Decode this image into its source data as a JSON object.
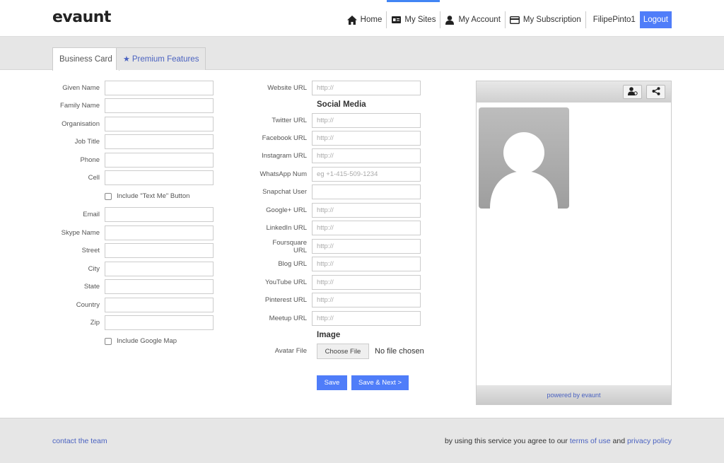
{
  "header": {
    "logo": "evaunt",
    "nav": [
      {
        "label": "Home",
        "icon": "home-icon"
      },
      {
        "label": "My Sites",
        "icon": "id-card-icon"
      },
      {
        "label": "My Account",
        "icon": "user-icon"
      },
      {
        "label": "My Subscription",
        "icon": "credit-card-icon"
      }
    ],
    "username": "FilipePinto1",
    "logout_label": "Logout"
  },
  "tabs": [
    {
      "label": "Business Card"
    },
    {
      "label": "Premium Features",
      "icon": "star-icon"
    }
  ],
  "form_left": {
    "fields": [
      {
        "label": "Given Name",
        "value": ""
      },
      {
        "label": "Family Name",
        "value": ""
      },
      {
        "label": "Organisation",
        "value": ""
      },
      {
        "label": "Job Title",
        "value": ""
      },
      {
        "label": "Phone",
        "value": ""
      },
      {
        "label": "Cell",
        "value": ""
      }
    ],
    "text_me_label": "Include \"Text Me\" Button",
    "fields2": [
      {
        "label": "Email",
        "value": ""
      },
      {
        "label": "Skype Name",
        "value": ""
      },
      {
        "label": "Street",
        "value": ""
      },
      {
        "label": "City",
        "value": ""
      },
      {
        "label": "State",
        "value": ""
      },
      {
        "label": "Country",
        "value": ""
      },
      {
        "label": "Zip",
        "value": ""
      }
    ],
    "google_map_label": "Include Google Map"
  },
  "form_right": {
    "website": {
      "label": "Website URL",
      "placeholder": "http://"
    },
    "social_heading": "Social Media",
    "social": [
      {
        "label": "Twitter URL",
        "placeholder": "http://"
      },
      {
        "label": "Facebook URL",
        "placeholder": "http://"
      },
      {
        "label": "Instagram URL",
        "placeholder": "http://"
      },
      {
        "label": "WhatsApp Num",
        "placeholder": "eg +1-415-509-1234"
      },
      {
        "label": "Snapchat User",
        "placeholder": ""
      },
      {
        "label": "Google+ URL",
        "placeholder": "http://"
      },
      {
        "label": "LinkedIn URL",
        "placeholder": "http://"
      },
      {
        "label": "Foursquare URL",
        "placeholder": "http://"
      },
      {
        "label": "Blog URL",
        "placeholder": "http://"
      },
      {
        "label": "YouTube URL",
        "placeholder": "http://"
      },
      {
        "label": "Pinterest URL",
        "placeholder": "http://"
      },
      {
        "label": "Meetup URL",
        "placeholder": "http://"
      }
    ],
    "image_heading": "Image",
    "avatar_label": "Avatar File",
    "choose_file_label": "Choose File",
    "no_file_label": "No file chosen",
    "save_label": "Save",
    "save_next_label": "Save & Next >"
  },
  "preview": {
    "powered_by": "powered by evaunt"
  },
  "footer": {
    "contact": "contact the team",
    "terms_prefix": "by using this service you agree to our",
    "terms_link": "terms of use",
    "and": "and",
    "privacy_link": "privacy policy"
  },
  "colors": {
    "accent": "#4f7df9",
    "link": "#4a62c0",
    "band": "#e6e6e6"
  }
}
